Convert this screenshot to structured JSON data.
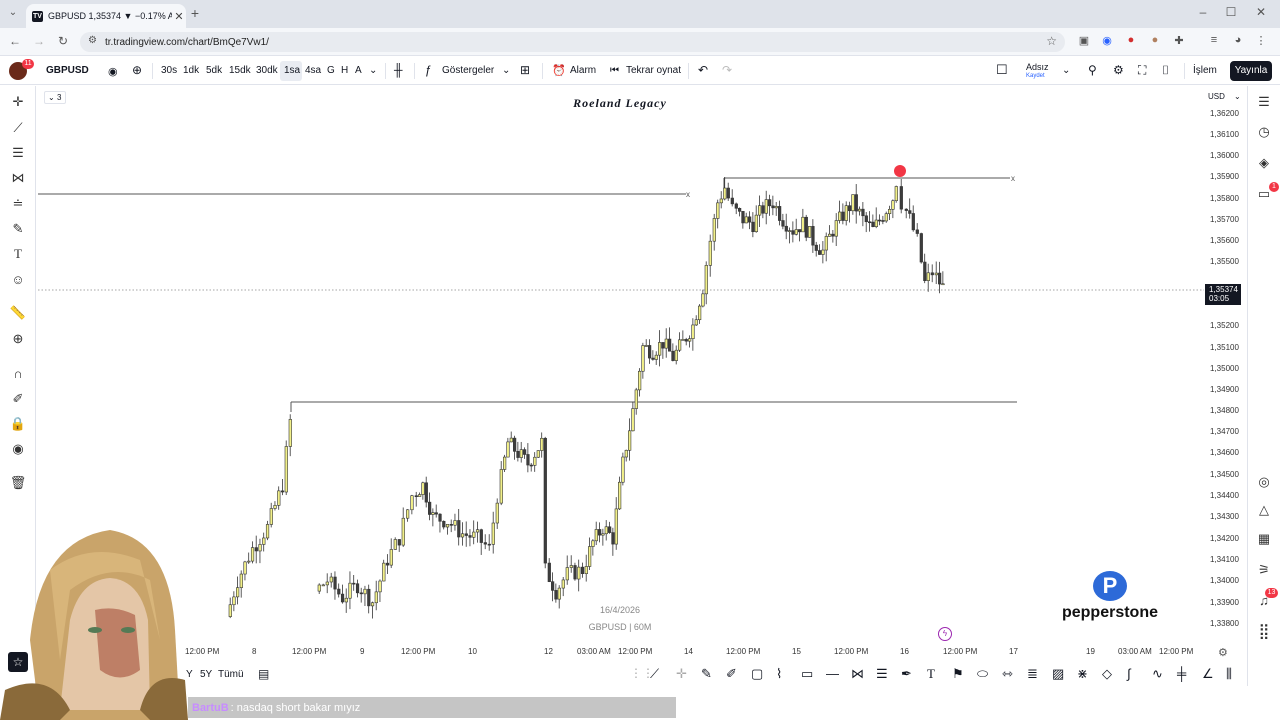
{
  "browser": {
    "tab_title": "GBPUSD 1,35374 ▼ −0.17% Ad",
    "tab_favicon": "TV",
    "new_tab": "+",
    "url": "tr.tradingview.com/chart/BmQe7Vw1/"
  },
  "toolbar": {
    "avatar_badge": "11",
    "symbol": "GBPUSD",
    "intervals": [
      "30s",
      "1dk",
      "5dk",
      "15dk",
      "30dk",
      "1sa",
      "4sa",
      "G",
      "H",
      "A"
    ],
    "active_interval": "1sa",
    "indicators": "Göstergeler",
    "alarm": "Alarm",
    "replay": "Tekrar oynat",
    "layout_name": "Adsız",
    "layout_sub": "Kaydet",
    "trade": "İşlem",
    "publish": "Yayınla"
  },
  "chart": {
    "title": "Roeland Legacy",
    "indicator_count": "3",
    "currency": "USD",
    "current_price": "1,35374",
    "countdown": "03:05",
    "watermark_date": "16/4/2026",
    "watermark_symbol": "GBPUSD | 60M",
    "price_labels": [
      "1,36200",
      "1,36100",
      "1,36000",
      "1,35900",
      "1,35800",
      "1,35700",
      "1,35600",
      "1,35500",
      "1,35200",
      "1,35100",
      "1,35000",
      "1,34900",
      "1,34800",
      "1,34700",
      "1,34600",
      "1,34500",
      "1,34400",
      "1,34300",
      "1,34200",
      "1,34100",
      "1,34000",
      "1,33900",
      "1,33800"
    ],
    "time_labels": [
      "12:00 PM",
      "8",
      "12:00 PM",
      "9",
      "12:00 PM",
      "10",
      "12",
      "03:00 AM",
      "12:00 PM",
      "14",
      "12:00 PM",
      "15",
      "12:00 PM",
      "16",
      "12:00 PM",
      "17",
      "19",
      "03:00 AM",
      "12:00 PM"
    ],
    "line_end_marker": "x",
    "brand": "pepperstone",
    "colors": {
      "bull": "#f2f08a",
      "bear": "#3d3d3d",
      "marker": "#f23645"
    }
  },
  "bottom": {
    "range_labels": [
      "Y",
      "5Y",
      "Tümü"
    ]
  },
  "right_badges": {
    "chat": "1",
    "notifications": "13"
  },
  "stream_chat": {
    "user": "BartuB",
    "message": ": nasdaq short bakar mıyız"
  }
}
